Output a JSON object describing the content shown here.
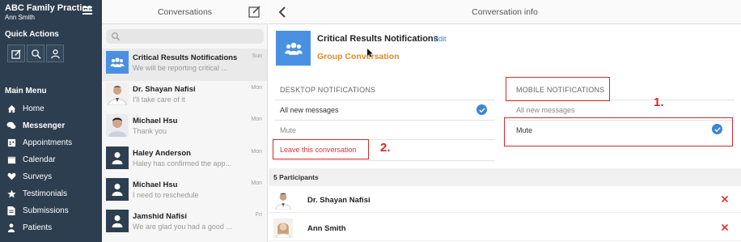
{
  "sidebar": {
    "brand_title": "ABC Family Practice",
    "brand_user": "Ann Smith",
    "quick_actions_title": "Quick Actions",
    "quick_actions": [
      "compose-icon",
      "search-icon",
      "contact-icon"
    ],
    "main_menu_title": "Main Menu",
    "menu": [
      {
        "label": "Home",
        "icon": "home-icon"
      },
      {
        "label": "Messenger",
        "icon": "chat-icon"
      },
      {
        "label": "Appointments",
        "icon": "appointments-icon"
      },
      {
        "label": "Calendar",
        "icon": "calendar-icon"
      },
      {
        "label": "Surveys",
        "icon": "heart-icon"
      },
      {
        "label": "Testimonials",
        "icon": "star-icon"
      },
      {
        "label": "Submissions",
        "icon": "document-icon"
      },
      {
        "label": "Patients",
        "icon": "person-icon"
      }
    ]
  },
  "conversations": {
    "title": "Conversations",
    "items": [
      {
        "name": "Critical Results Notifications",
        "preview": "We will be reporting critical ...",
        "time": "Sun"
      },
      {
        "name": "Dr. Shayan Nafisi",
        "preview": "I'll take care of it",
        "time": "Mon"
      },
      {
        "name": "Michael Hsu",
        "preview": "Thank you",
        "time": "Mon"
      },
      {
        "name": "Haley Anderson",
        "preview": "Haley has confirmed the app...",
        "time": "Mon"
      },
      {
        "name": "Michael Hsu",
        "preview": "I need to reschedule",
        "time": "Mon"
      },
      {
        "name": "Jamshid Nafisi",
        "preview": "We are glad you had a good ...",
        "time": "Fri"
      }
    ]
  },
  "info": {
    "title": "Conversation info",
    "group_name": "Critical Results Notifications",
    "edit_label": "Edit",
    "group_type": "Group Conversation",
    "desktop_heading": "DESKTOP NOTIFICATIONS",
    "mobile_heading": "MOBILE NOTIFICATIONS",
    "desktop_all": "All new messages",
    "desktop_mute": "Mute",
    "mobile_all": "All new messages",
    "mobile_mute": "Mute",
    "leave_label": "Leave this conversation",
    "annotation_1": "1.",
    "annotation_2": "2.",
    "participants_title": "5 Participants",
    "participants": [
      {
        "name": "Dr. Shayan Nafisi"
      },
      {
        "name": "Ann Smith"
      }
    ]
  },
  "colors": {
    "sidebar": "#2d3e50",
    "accent_blue": "#4a90e2",
    "group_type_orange": "#e08a2c",
    "annotation_red": "#d32a2a"
  }
}
